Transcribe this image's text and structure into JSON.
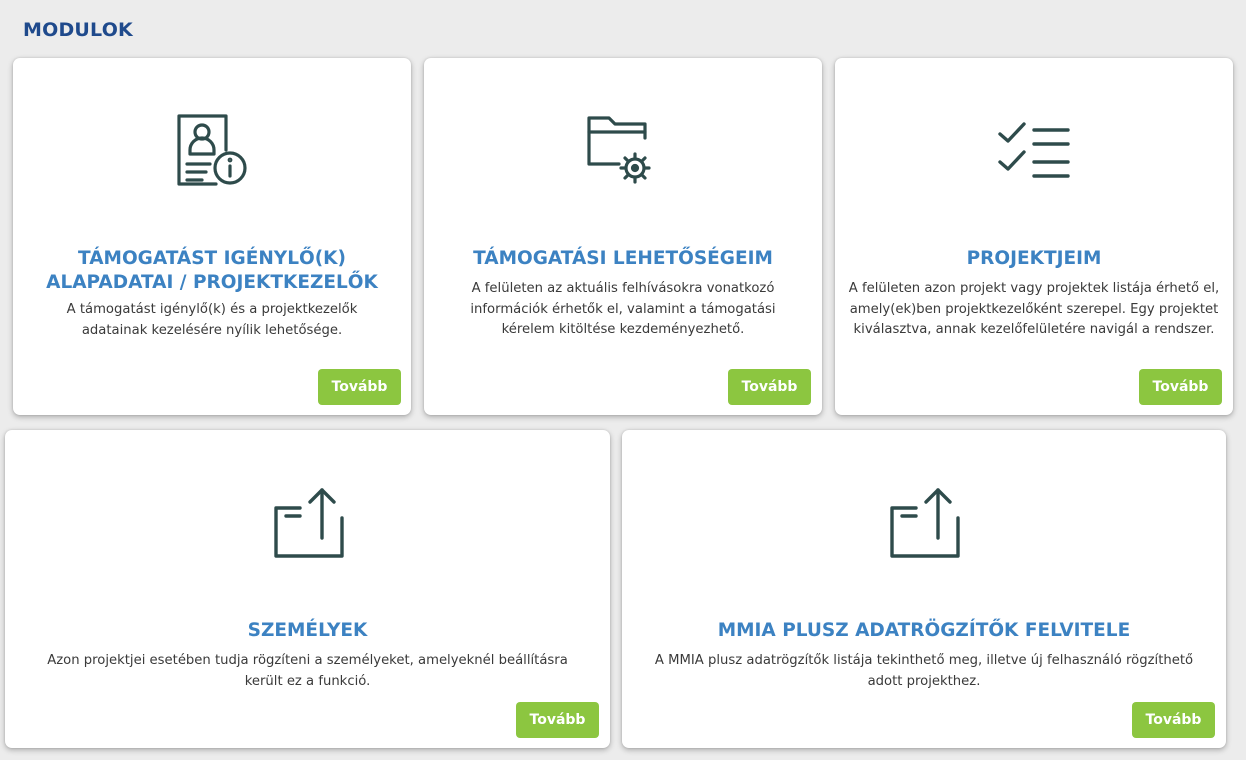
{
  "page": {
    "title": "MODULOK"
  },
  "cards": [
    {
      "icon": "profile-info-icon",
      "title": "TÁMOGATÁST IGÉNYLŐ(K) ALAPADATAI / PROJEKTKEZELŐK",
      "description": "A támogatást igénylő(k) és a projektkezelők adatainak kezelésére nyílik lehetősége.",
      "button": "Tovább"
    },
    {
      "icon": "folder-settings-icon",
      "title": "TÁMOGATÁSI LEHETŐSÉGEIM",
      "description": "A felületen az aktuális felhívásokra vonatkozó információk érhetők el, valamint a támogatási kérelem kitöltése kezdeményezhető.",
      "button": "Tovább"
    },
    {
      "icon": "checklist-icon",
      "title": "PROJEKTJEIM",
      "description": "A felületen azon projekt vagy projektek listája érhető el, amely(ek)ben projektkezelőként szerepel. Egy projektet kiválasztva, annak kezelőfelületére navigál a rendszer.",
      "button": "Tovább"
    },
    {
      "icon": "share-export-icon",
      "title": "SZEMÉLYEK",
      "description": "Azon projektjei esetében tudja rögzíteni a személyeket, amelyeknél beállításra került ez a funkció.",
      "button": "Tovább"
    },
    {
      "icon": "share-export-icon",
      "title": "MMIA PLUSZ ADATRÖGZÍTŐK FELVITELE",
      "description": "A MMIA plusz adatrögzítők listája tekinthető meg, illetve új felhasználó rögzíthető adott projekthez.",
      "button": "Tovább"
    }
  ],
  "colors": {
    "title": "#1f4a8c",
    "card_title": "#3c82c2",
    "button": "#8cc640",
    "icon": "#2e4b4b"
  }
}
